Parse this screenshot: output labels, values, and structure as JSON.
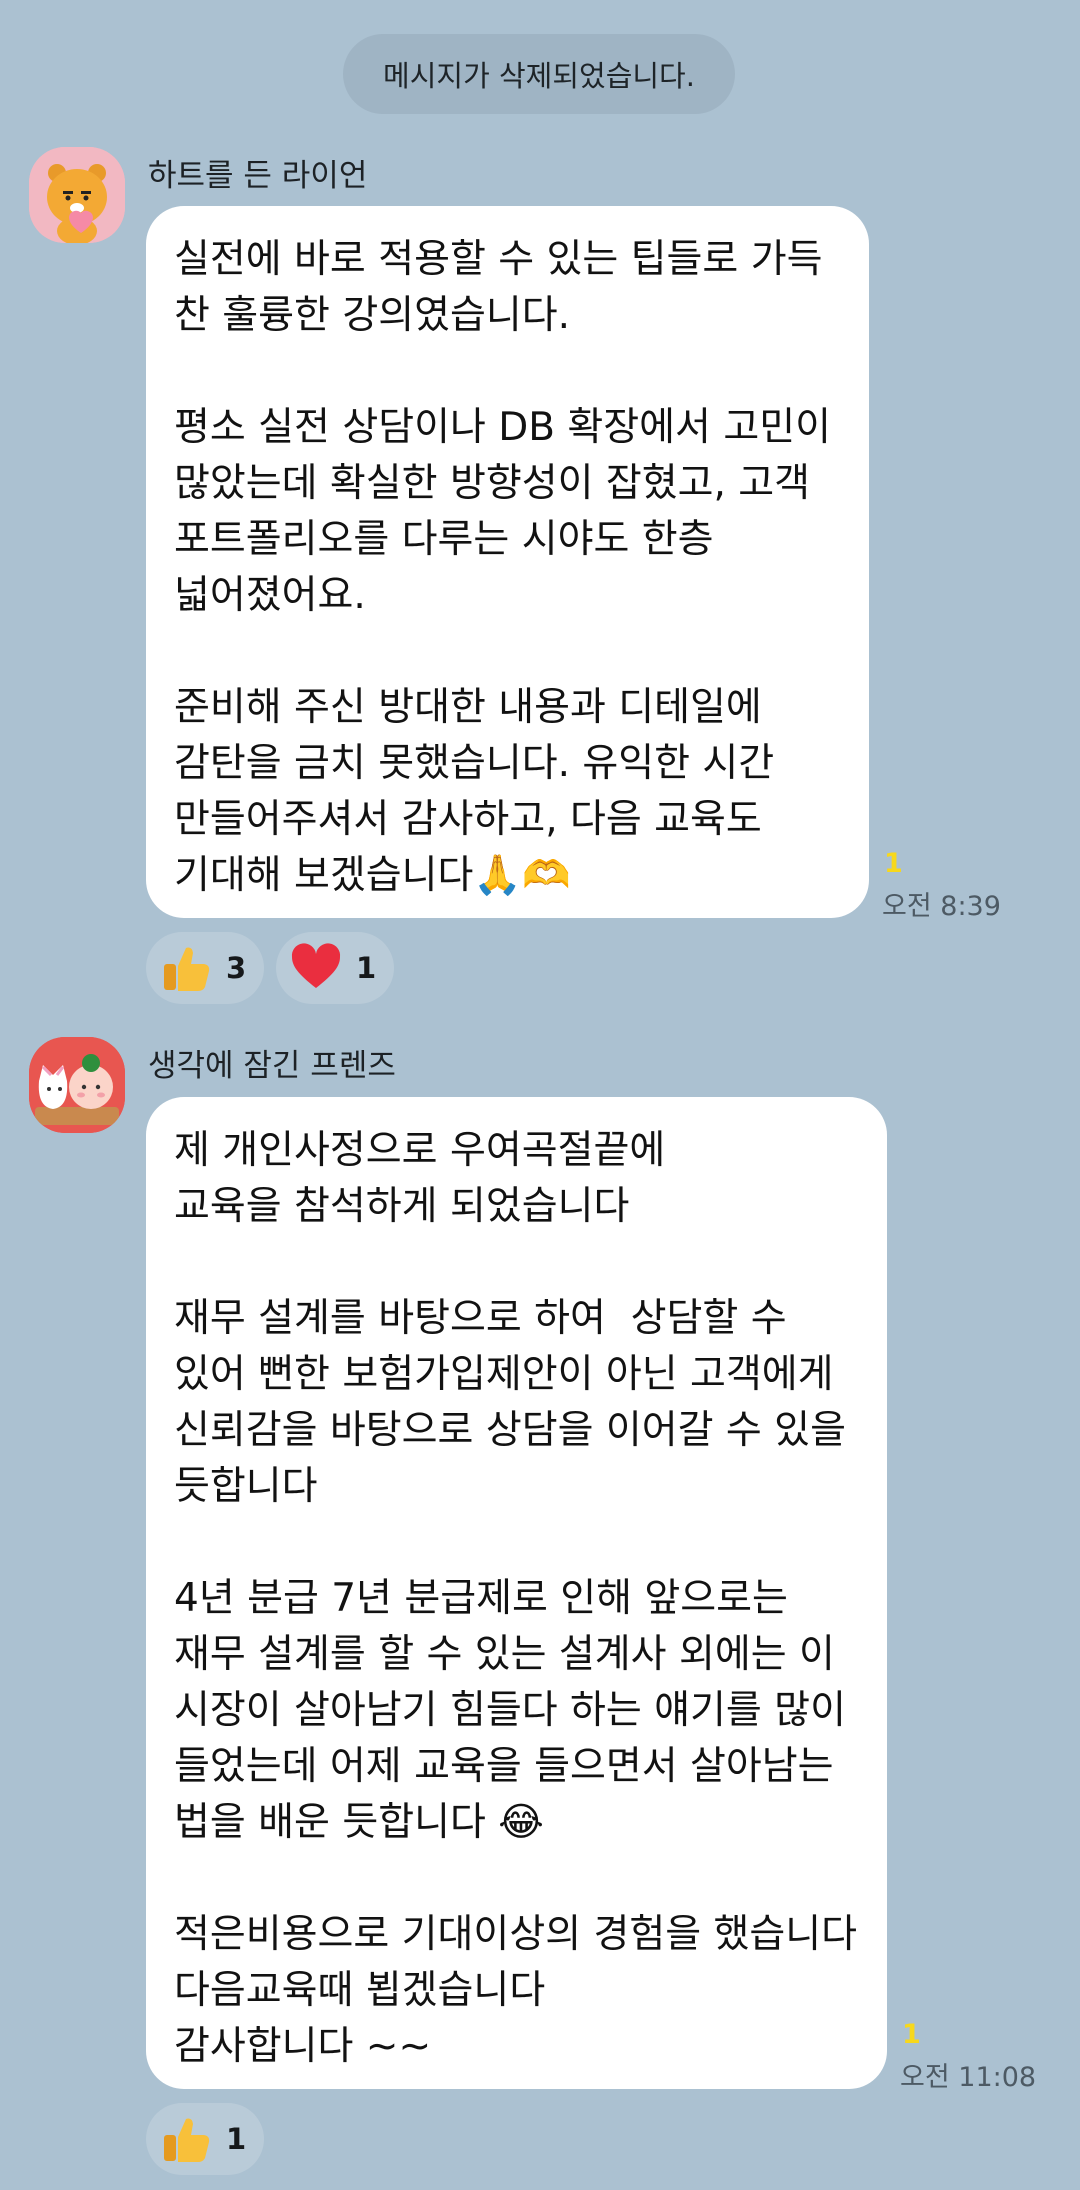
{
  "system_message": "메시지가 삭제되었습니다.",
  "messages": [
    {
      "sender": "하트를 든 라이언",
      "avatar_icon": "ryan-holding-heart-icon",
      "text": "실전에 바로 적용할 수 있는 팁들로 가득\n찬 훌륭한 강의였습니다.\n\n평소 실전 상담이나 DB 확장에서 고민이\n많았는데 확실한 방향성이 잡혔고, 고객\n포트폴리오를 다루는 시야도 한층\n넓어졌어요.\n\n준비해 주신 방대한 내용과 디테일에\n감탄을 금치 못했습니다. 유익한 시간\n만들어주셔서 감사하고, 다음 교육도\n기대해 보겠습니다🙏🫶",
      "unread": "1",
      "time": "오전 8:39",
      "reactions": [
        {
          "icon": "thumbs-up-icon",
          "count": "3"
        },
        {
          "icon": "heart-icon",
          "count": "1"
        }
      ]
    },
    {
      "sender": "생각에 잠긴 프렌즈",
      "avatar_icon": "thinking-friends-icon",
      "text": "제 개인사정으로 우여곡절끝에\n교육을 참석하게 되었습니다\n\n재무 설계를 바탕으로 하여  상담할 수\n있어 뻔한 보험가입제안이 아닌 고객에게\n신뢰감을 바탕으로 상담을 이어갈 수 있을\n듯합니다\n\n4년 분급 7년 분급제로 인해 앞으로는\n재무 설계를 할 수 있는 설계사 외에는 이\n시장이 살아남기 힘들다 하는 얘기를 많이\n들었는데 어제 교육을 들으면서 살아남는\n법을 배운 듯합니다 😂\n\n적은비용으로 기대이상의 경험을 했습니다\n다음교육때 뵙겠습니다\n감사합니다 ~~",
      "unread": "1",
      "time": "오전 11:08",
      "reactions": [
        {
          "icon": "thumbs-up-icon",
          "count": "1"
        }
      ]
    }
  ],
  "colors": {
    "background": "#abc1d1",
    "bubble": "#ffffff",
    "unread": "#f7d81c",
    "reaction_chip": "#b9cbd8"
  }
}
